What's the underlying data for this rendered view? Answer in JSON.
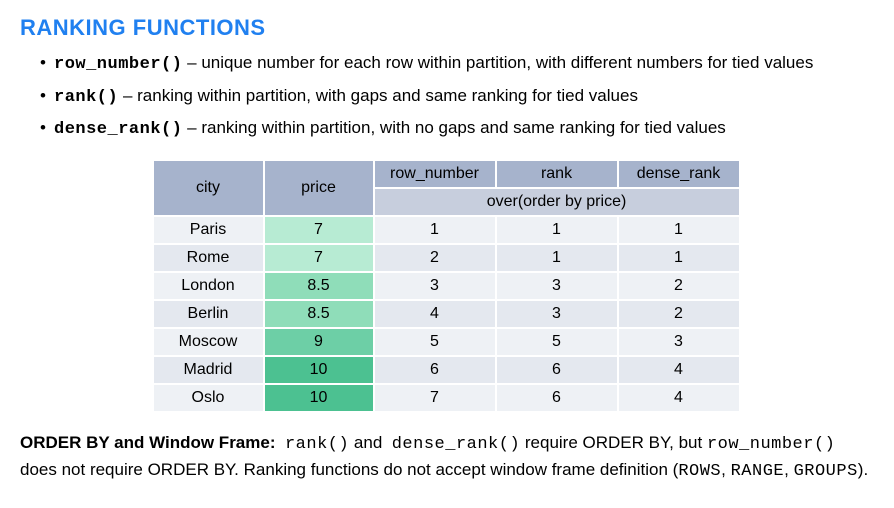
{
  "heading": "RANKING FUNCTIONS",
  "bullets": [
    {
      "fn": "row_number()",
      "desc": " – unique number for each row within partition, with different numbers for tied values"
    },
    {
      "fn": "rank()",
      "desc": " – ranking within partition, with gaps and same ranking for tied values"
    },
    {
      "fn": "dense_rank()",
      "desc": " – ranking within partition, with no gaps and same ranking for tied values"
    }
  ],
  "table": {
    "headers": {
      "city": "city",
      "price": "price",
      "row_number": "row_number",
      "rank": "rank",
      "dense_rank": "dense_rank"
    },
    "subheader": "over(order by price)",
    "rows": [
      {
        "city": "Paris",
        "price": "7",
        "rn": "1",
        "rk": "1",
        "dr": "1",
        "priceColor": "#b7ebd3"
      },
      {
        "city": "Rome",
        "price": "7",
        "rn": "2",
        "rk": "1",
        "dr": "1",
        "priceColor": "#b7ebd3"
      },
      {
        "city": "London",
        "price": "8.5",
        "rn": "3",
        "rk": "3",
        "dr": "2",
        "priceColor": "#8fddb9"
      },
      {
        "city": "Berlin",
        "price": "8.5",
        "rn": "4",
        "rk": "3",
        "dr": "2",
        "priceColor": "#8fddb9"
      },
      {
        "city": "Moscow",
        "price": "9",
        "rn": "5",
        "rk": "5",
        "dr": "3",
        "priceColor": "#6dcfa6"
      },
      {
        "city": "Madrid",
        "price": "10",
        "rn": "6",
        "rk": "6",
        "dr": "4",
        "priceColor": "#4cc191"
      },
      {
        "city": "Oslo",
        "price": "10",
        "rn": "7",
        "rk": "6",
        "dr": "4",
        "priceColor": "#4cc191"
      }
    ]
  },
  "footnote": {
    "lead_bold": "ORDER BY and Window Frame:",
    "part1": "rank()",
    "part2": " and ",
    "part3": "dense_rank()",
    "part4": " require ORDER BY, but ",
    "part5": "row_number()",
    "part6": " does not require ORDER BY. Ranking functions do not accept window frame definition (",
    "part7": "ROWS",
    "part8": ", ",
    "part9": "RANGE",
    "part10": ", ",
    "part11": "GROUPS",
    "part12": ")."
  }
}
